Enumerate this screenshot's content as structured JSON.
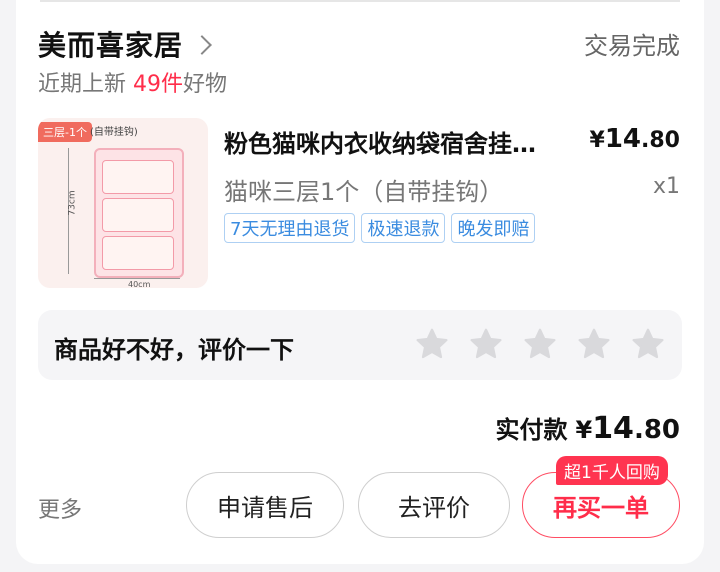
{
  "shop": {
    "name": "美而喜家居",
    "status": "交易完成",
    "sub_prefix": "近期上新",
    "sub_count": "49件",
    "sub_suffix": "好物"
  },
  "product": {
    "title": "粉色猫咪内衣收纳袋宿舍挂墙式墙上",
    "price_currency": "¥",
    "price_int": "14",
    "price_dec": ".80",
    "spec": "猫咪三层1个（自带挂钩）",
    "quantity": "x1",
    "tags": [
      "7天无理由退货",
      "极速退款",
      "晚发即赔"
    ],
    "image": {
      "tag": "三层-1个",
      "tag2": "(自带挂钩)",
      "height_label": "73cm",
      "width_label": "40cm"
    }
  },
  "review": {
    "prompt": "商品好不好，评价一下",
    "stars": 5,
    "star_color": "#d9d9dc"
  },
  "payment": {
    "label": "实付款",
    "currency": "¥",
    "int": "14",
    "dec": ".80"
  },
  "actions": {
    "more": "更多",
    "after_sale": "申请售后",
    "review": "去评价",
    "rebuy": "再买一单",
    "rebuy_badge": "超1千人回购"
  },
  "colors": {
    "accent": "#ff2d4a",
    "tag_blue": "#3b8ce0"
  }
}
